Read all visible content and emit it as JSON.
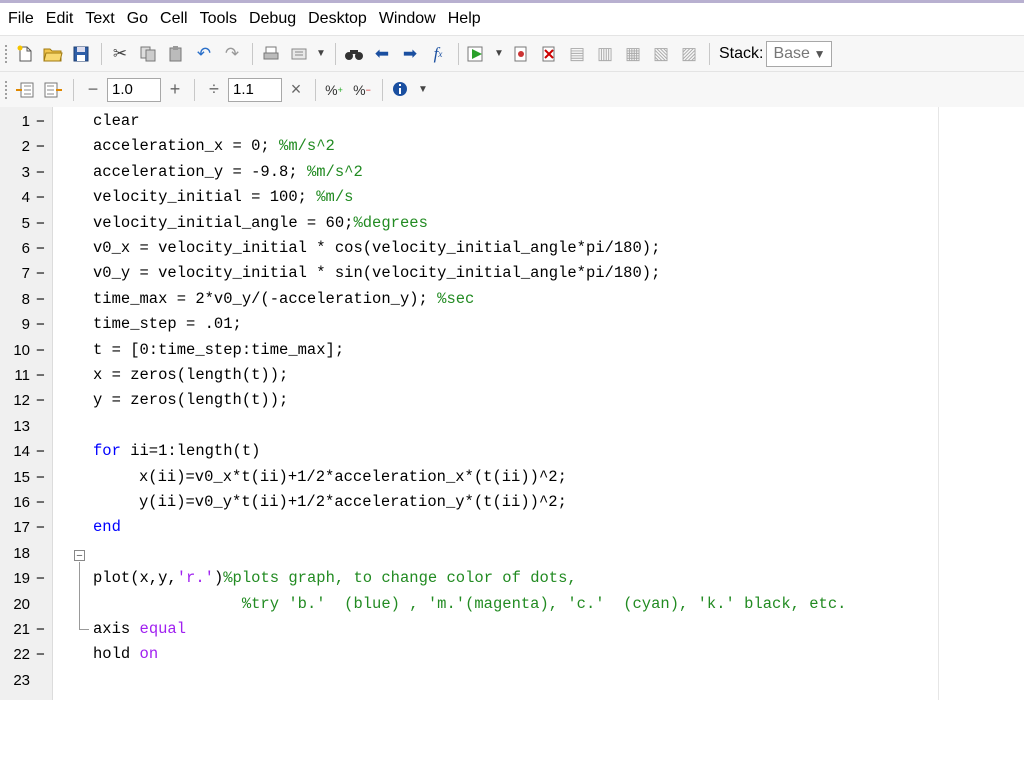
{
  "menu": [
    "File",
    "Edit",
    "Text",
    "Go",
    "Cell",
    "Tools",
    "Debug",
    "Desktop",
    "Window",
    "Help"
  ],
  "toolbar": {
    "stack_label": "Stack:",
    "stack_value": "Base"
  },
  "cell_toolbar": {
    "minus": "−",
    "decrement_value": "1.0",
    "plus": "+",
    "divide": "÷",
    "multiply_value": "1.1",
    "times": "×"
  },
  "editor": {
    "lines": [
      {
        "n": "1",
        "dash": "−",
        "code": "clear"
      },
      {
        "n": "2",
        "dash": "−",
        "code": "acceleration_x = 0; ",
        "comment": "%m/s^2"
      },
      {
        "n": "3",
        "dash": "−",
        "code": "acceleration_y = -9.8; ",
        "comment": "%m/s^2"
      },
      {
        "n": "4",
        "dash": "−",
        "code": "velocity_initial = 100; ",
        "comment": "%m/s"
      },
      {
        "n": "5",
        "dash": "−",
        "code": "velocity_initial_angle = 60;",
        "comment": "%degrees"
      },
      {
        "n": "6",
        "dash": "−",
        "code": "v0_x = velocity_initial * cos(velocity_initial_angle*pi/180);"
      },
      {
        "n": "7",
        "dash": "−",
        "code": "v0_y = velocity_initial * sin(velocity_initial_angle*pi/180);"
      },
      {
        "n": "8",
        "dash": "−",
        "code": "time_max = 2*v0_y/(-acceleration_y); ",
        "comment": "%sec"
      },
      {
        "n": "9",
        "dash": "−",
        "code": "time_step = .01;"
      },
      {
        "n": "10",
        "dash": "−",
        "code": "t = [0:time_step:time_max];"
      },
      {
        "n": "11",
        "dash": "−",
        "code": "x = zeros(length(t));"
      },
      {
        "n": "12",
        "dash": "−",
        "code": "y = zeros(length(t));"
      },
      {
        "n": "13",
        "dash": "",
        "code": ""
      },
      {
        "n": "14",
        "dash": "−",
        "keyword": "for",
        "code": " ii=1:length(t)"
      },
      {
        "n": "15",
        "dash": "−",
        "code": "x(ii)=v0_x*t(ii)+1/2*acceleration_x*(t(ii))^2;",
        "indent": true
      },
      {
        "n": "16",
        "dash": "−",
        "code": "y(ii)=v0_y*t(ii)+1/2*acceleration_y*(t(ii))^2;",
        "indent": true
      },
      {
        "n": "17",
        "dash": "−",
        "keyword": "end",
        "code": ""
      },
      {
        "n": "18",
        "dash": "",
        "code": ""
      },
      {
        "n": "19",
        "dash": "−",
        "code": "plot(x,y,",
        "string": "'r.'",
        "code2": ")",
        "comment": "%plots graph, to change color of dots,"
      },
      {
        "n": "20",
        "dash": "",
        "code": "                ",
        "comment": "%try 'b.'  (blue) , 'm.'(magenta), 'c.'  (cyan), 'k.' black, etc."
      },
      {
        "n": "21",
        "dash": "−",
        "code": "axis ",
        "string": "equal"
      },
      {
        "n": "22",
        "dash": "−",
        "code": "hold ",
        "string": "on"
      },
      {
        "n": "23",
        "dash": "",
        "code": ""
      }
    ]
  },
  "colors": {
    "comment": "#228b22",
    "keyword": "#0000ff",
    "string": "#a020f0",
    "gutter": "#f0f0f0"
  }
}
